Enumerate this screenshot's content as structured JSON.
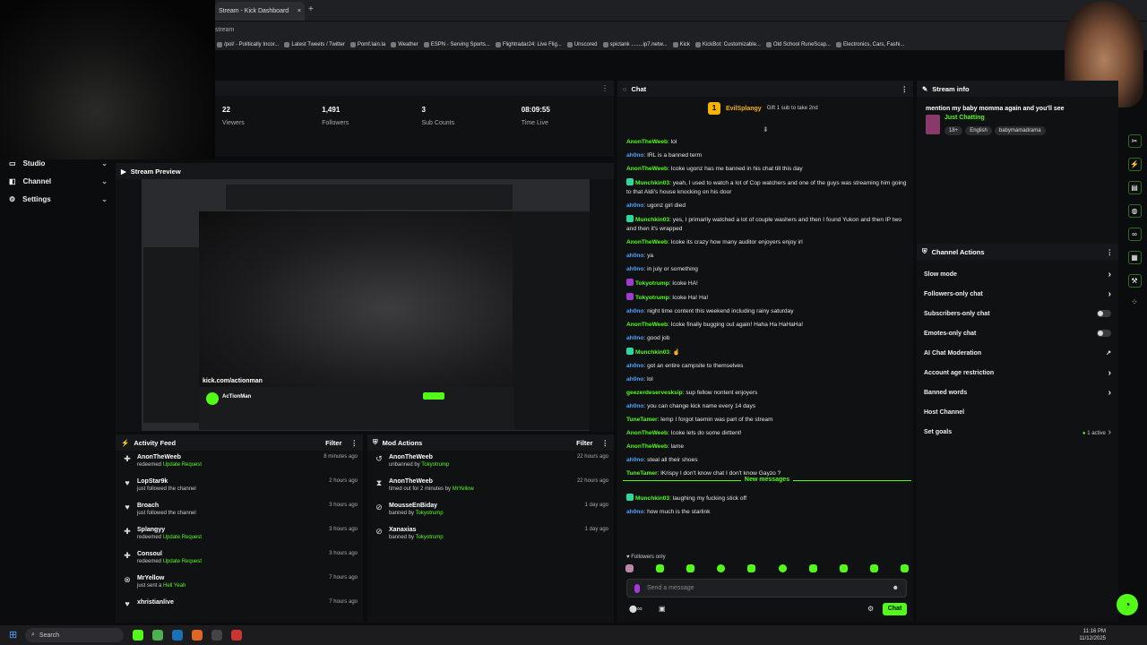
{
  "browser": {
    "tab_title": "Stream - Kick Dashboard",
    "tab_close": "×",
    "new_tab": "+",
    "url": "stream",
    "bookmarks": [
      "/pol/ - Politically Incor...",
      "Latest Tweets / Twitter",
      "Pomf.lain.la",
      "Weather",
      "ESPN - Serving Sports...",
      "Flightradar24: Live Flig...",
      "Unscored",
      "spictank ........ip7.netw...",
      "Kick",
      "KickBot: Customizable...",
      "Old School RuneScap...",
      "Electronics, Cars, Fashi..."
    ]
  },
  "nav": [
    {
      "label": "Studio",
      "icon": "studio-icon"
    },
    {
      "label": "Channel",
      "icon": "channel-icon"
    },
    {
      "label": "Settings",
      "icon": "gear-icon"
    }
  ],
  "stats": [
    {
      "value": "22",
      "label": "Viewers"
    },
    {
      "value": "1,491",
      "label": "Followers"
    },
    {
      "value": "3",
      "label": "Sub Counts"
    },
    {
      "value": "08:09:55",
      "label": "Time Live"
    }
  ],
  "preview": {
    "title": "Stream Preview",
    "overlay_url": "kick.com/actionman",
    "streamer": "AcTionMan"
  },
  "activity": {
    "title": "Activity Feed",
    "filter": "Filter",
    "items": [
      {
        "name": "AnonTheWeeb",
        "desc": "redeemed",
        "em": "Update Request",
        "time": "8 minutes ago",
        "icon": "reward-icon"
      },
      {
        "name": "LopStar9k",
        "desc": "just followed the channel",
        "em": "",
        "time": "2 hours ago",
        "icon": "heart-icon"
      },
      {
        "name": "Broach",
        "desc": "just followed the channel",
        "em": "",
        "time": "3 hours ago",
        "icon": "heart-icon"
      },
      {
        "name": "Splangyy",
        "desc": "redeemed",
        "em": "Update Request",
        "time": "3 hours ago",
        "icon": "reward-icon"
      },
      {
        "name": "Consoul",
        "desc": "redeemed",
        "em": "Update Request",
        "time": "3 hours ago",
        "icon": "reward-icon"
      },
      {
        "name": "MrYellow",
        "desc": "just sent a",
        "em": "Hell Yeah",
        "time": "7 hours ago",
        "icon": "kicks-icon"
      },
      {
        "name": "xhristianlive",
        "desc": "",
        "em": "",
        "time": "7 hours ago",
        "icon": "heart-icon"
      }
    ]
  },
  "modactions": {
    "title": "Mod Actions",
    "filter": "Filter",
    "items": [
      {
        "name": "AnonTheWeeb",
        "desc": "unbanned by",
        "em": "Tokyotrump",
        "time": "22 hours ago",
        "icon": "unban-icon"
      },
      {
        "name": "AnonTheWeeb",
        "desc": "timed out for 2 minutes by",
        "em": "MrYellow",
        "time": "22 hours ago",
        "icon": "hourglass-icon"
      },
      {
        "name": "MousseEnBiday",
        "desc": "banned by",
        "em": "Tokyotrump",
        "time": "1 day ago",
        "icon": "ban-icon"
      },
      {
        "name": "Xanaxias",
        "desc": "banned by",
        "em": "Tokyotrump",
        "time": "1 day ago",
        "icon": "ban-icon"
      }
    ]
  },
  "chat": {
    "title": "Chat",
    "pinned_user": "EvilSplangy",
    "pinned_count": "1",
    "pinned_gift": "Gift 1 sub to take 2nd",
    "messages": [
      {
        "user": "AnonTheWeeb",
        "text": "lol",
        "c": ""
      },
      {
        "user": "ah0no",
        "text": "IRL is a banned term",
        "c": "b"
      },
      {
        "user": "AnonTheWeeb",
        "text": "Icoke ugonz has me banned in his chat till this day",
        "c": ""
      },
      {
        "user": "Munchkin03",
        "text": "yeah, I used to watch a lot of Cop watchers and one of the guys was streaming him going to that Aldi's house knocking on his door",
        "c": "",
        "badge": true
      },
      {
        "user": "ah0no",
        "text": "ugonz girl died",
        "c": "b"
      },
      {
        "user": "Munchkin03",
        "text": "yes, I primarily watched a lot of couple washers and then I found Yukon and then IP two and then it's wrapped",
        "c": "",
        "badge": true
      },
      {
        "user": "AnonTheWeeb",
        "text": "Icoke its crazy how many auditor enjoyers enjoy irl",
        "c": ""
      },
      {
        "user": "ah0no",
        "text": "ya",
        "c": "b"
      },
      {
        "user": "ah0no",
        "text": "in july or something",
        "c": "b"
      },
      {
        "user": "Tokyotrump",
        "text": "Icoke HA!",
        "c": "",
        "badge": true
      },
      {
        "user": "Tokyotrump",
        "text": "Icoke Ha! Ha!",
        "c": "",
        "badge": true
      },
      {
        "user": "ah0no",
        "text": "night time content this weekend including rainy saturday",
        "c": "b"
      },
      {
        "user": "AnonTheWeeb",
        "text": "Icoke finally bugging out again! Haha Ha HaHaHa!",
        "c": ""
      },
      {
        "user": "ah0no",
        "text": "good job",
        "c": "b"
      },
      {
        "user": "Munchkin03",
        "text": "☝",
        "c": "",
        "badge": true
      },
      {
        "user": "ah0no",
        "text": "got an entire campsite to themselves",
        "c": "b"
      },
      {
        "user": "ah0no",
        "text": "lol",
        "c": "b"
      },
      {
        "user": "geezerdeservesksip",
        "text": "sup fellow nontent enjoyers",
        "c": ""
      },
      {
        "user": "ah0no",
        "text": "you can change kick name every 14 days",
        "c": "b"
      },
      {
        "user": "TuneTamer",
        "text": "lemp I forgot taemin was part of the stream",
        "c": ""
      },
      {
        "user": "AnonTheWeeb",
        "text": "Icoke lets do some dirttent!",
        "c": ""
      },
      {
        "user": "AnonTheWeeb",
        "text": "lame",
        "c": ""
      },
      {
        "user": "ah0no",
        "text": "steal all their shoes",
        "c": "b"
      },
      {
        "user": "TuneTamer",
        "text": "lKrispy I don't know chat I don't know Gayzo ?",
        "c": ""
      }
    ],
    "new_label": "New messages",
    "new_messages": [
      {
        "user": "Munchkin03",
        "text": "laughing my fucking stick off",
        "c": "",
        "badge": true
      },
      {
        "user": "ah0no",
        "text": "how much is the starlink",
        "c": "b"
      }
    ],
    "followers_only": "Followers only",
    "placeholder": "Send a message",
    "send": "Chat"
  },
  "streaminfo": {
    "title": "Stream info",
    "stream_title": "mention my baby momma again and you'll see",
    "category": "Just Chatting",
    "tags": [
      "18+",
      "English",
      "babymamadrama"
    ]
  },
  "channelactions": {
    "title": "Channel Actions",
    "items": [
      {
        "label": "Slow mode",
        "ctl": "chev"
      },
      {
        "label": "Followers-only chat",
        "ctl": "chev"
      },
      {
        "label": "Subscribers-only chat",
        "ctl": "toggle"
      },
      {
        "label": "Emotes-only chat",
        "ctl": "toggle"
      },
      {
        "label": "AI Chat Moderation",
        "ctl": "ext"
      },
      {
        "label": "Account age restriction",
        "ctl": "chev"
      },
      {
        "label": "Banned words",
        "ctl": "chev"
      },
      {
        "label": "Host Channel",
        "ctl": ""
      },
      {
        "label": "Set goals",
        "ctl": "active"
      }
    ],
    "active_label": "1 active"
  },
  "taskbar": {
    "search": "Search",
    "time": "11:16 PM",
    "date": "11/12/2025"
  },
  "colors": {
    "accent": "#53fc18",
    "bg": "#101113"
  }
}
